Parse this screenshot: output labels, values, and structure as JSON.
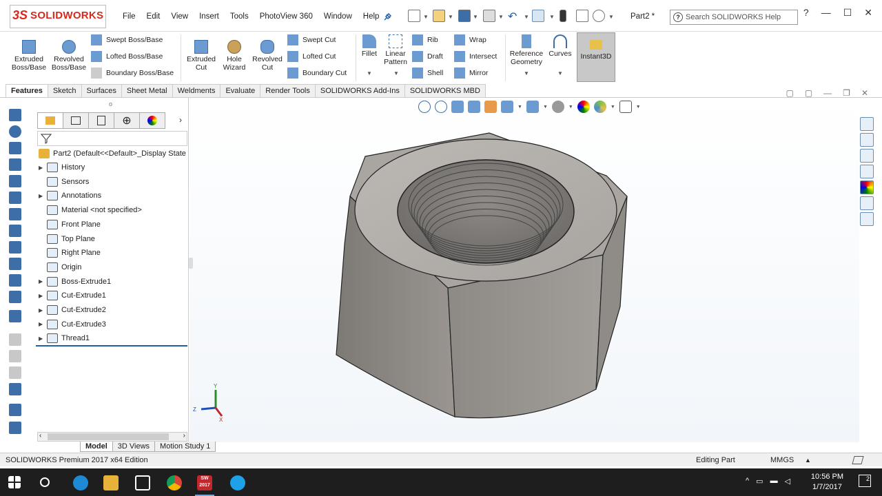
{
  "app": {
    "brand_prefix": "3S",
    "brand": "SOLIDWORKS",
    "doc_title": "Part2 *"
  },
  "menu": [
    "File",
    "Edit",
    "View",
    "Insert",
    "Tools",
    "PhotoView 360",
    "Window",
    "Help"
  ],
  "search": {
    "placeholder": "Search SOLIDWORKS Help"
  },
  "commands": {
    "extruded_boss": "Extruded\nBoss/Base",
    "revolved_boss": "Revolved\nBoss/Base",
    "swept_boss": "Swept Boss/Base",
    "lofted_boss": "Lofted Boss/Base",
    "boundary_boss": "Boundary Boss/Base",
    "extruded_cut": "Extruded\nCut",
    "hole_wizard": "Hole\nWizard",
    "revolved_cut": "Revolved\nCut",
    "swept_cut": "Swept Cut",
    "lofted_cut": "Lofted Cut",
    "boundary_cut": "Boundary Cut",
    "fillet": "Fillet",
    "linear_pattern": "Linear\nPattern",
    "rib": "Rib",
    "draft": "Draft",
    "shell": "Shell",
    "wrap": "Wrap",
    "intersect": "Intersect",
    "mirror": "Mirror",
    "reference_geometry": "Reference\nGeometry",
    "curves": "Curves",
    "instant3d": "Instant3D"
  },
  "tabs": [
    "Features",
    "Sketch",
    "Surfaces",
    "Sheet Metal",
    "Weldments",
    "Evaluate",
    "Render Tools",
    "SOLIDWORKS Add-Ins",
    "SOLIDWORKS MBD"
  ],
  "tree": {
    "root": "Part2  (Default<<Default>_Display State",
    "items": [
      {
        "label": "History",
        "expandable": true
      },
      {
        "label": "Sensors",
        "expandable": false
      },
      {
        "label": "Annotations",
        "expandable": true
      },
      {
        "label": "Material <not specified>",
        "expandable": false
      },
      {
        "label": "Front Plane",
        "expandable": false
      },
      {
        "label": "Top Plane",
        "expandable": false
      },
      {
        "label": "Right Plane",
        "expandable": false
      },
      {
        "label": "Origin",
        "expandable": false
      },
      {
        "label": "Boss-Extrude1",
        "expandable": true
      },
      {
        "label": "Cut-Extrude1",
        "expandable": true
      },
      {
        "label": "Cut-Extrude2",
        "expandable": true
      },
      {
        "label": "Cut-Extrude3",
        "expandable": true
      },
      {
        "label": "Thread1",
        "expandable": true
      }
    ]
  },
  "bottom_tabs": [
    "Model",
    "3D Views",
    "Motion Study 1"
  ],
  "status": {
    "edition": "SOLIDWORKS Premium 2017 x64 Edition",
    "mode": "Editing Part",
    "units": "MMGS"
  },
  "triad": {
    "x": "X",
    "y": "Y",
    "z": "Z"
  },
  "taskbar": {
    "time": "10:56 PM",
    "date": "1/7/2017",
    "sw_badge": "SW\n2017",
    "notifications": "2"
  },
  "colors": {
    "brand_red": "#d52b1e",
    "accent_blue": "#1f5fa8",
    "taskbar": "#1e1e1e"
  }
}
